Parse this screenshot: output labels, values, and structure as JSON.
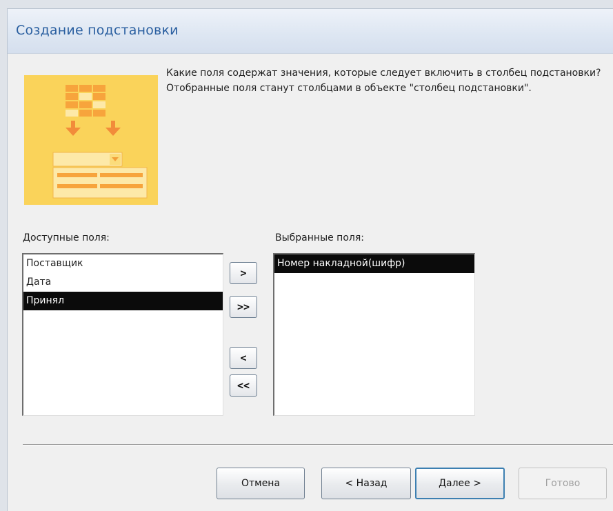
{
  "window": {
    "title": "Создание подстановки"
  },
  "description": "Какие поля содержат значения, которые следует включить в столбец подстановки? Отобранные поля станут столбцами в объекте \"столбец подстановки\".",
  "available": {
    "label": "Доступные поля:",
    "items": [
      {
        "label": "Поставщик",
        "selected": false
      },
      {
        "label": "Дата",
        "selected": false
      },
      {
        "label": "Принял",
        "selected": true
      }
    ]
  },
  "selected_fields": {
    "label": "Выбранные поля:",
    "items": [
      {
        "label": "Номер накладной(шифр)",
        "selected": true
      }
    ]
  },
  "move_buttons": {
    "add_one": ">",
    "add_all": ">>",
    "remove_one": "<",
    "remove_all": "<<"
  },
  "buttons": {
    "cancel": "Отмена",
    "back": "< Назад",
    "next": "Далее >",
    "finish": "Готово"
  },
  "colors": {
    "title": "#2a5fa0",
    "wizard_image": "#fad35a",
    "selection": "#0b0b0b"
  }
}
